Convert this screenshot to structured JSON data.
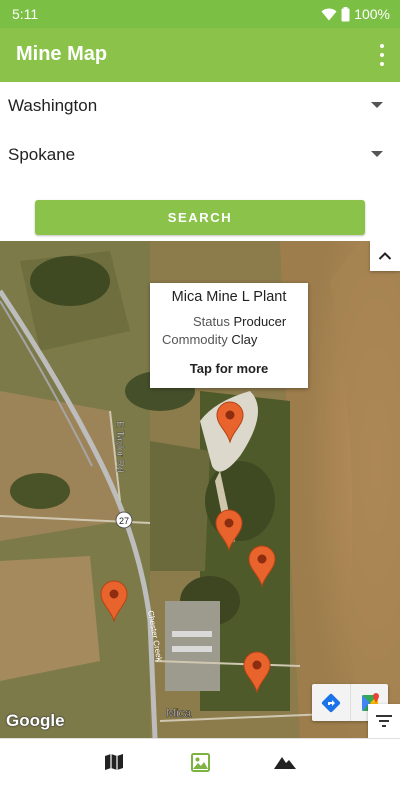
{
  "status_bar": {
    "time": "5:11",
    "battery": "100%",
    "icons": [
      "wifi-icon",
      "battery-icon"
    ]
  },
  "app_bar": {
    "title": "Mine Map",
    "menu_icon": "overflow-menu-icon"
  },
  "filters": {
    "state": {
      "value": "Washington"
    },
    "county": {
      "value": "Spokane"
    },
    "search_label": "SEARCH"
  },
  "map": {
    "info_window": {
      "title": "Mica Mine L Plant",
      "status_label": "Status",
      "status_value": "Producer",
      "commodity_label": "Commodity",
      "commodity_value": "Clay",
      "more_label": "Tap for more"
    },
    "markers": 5,
    "labels": {
      "road": "E Taylor Rd",
      "highway": "27",
      "creek": "Chester Creek",
      "town": "Mica"
    },
    "attribution": "Google",
    "colors": {
      "marker": "#e8642c",
      "marker_dot": "#8b2d0e"
    }
  },
  "bottom_nav": {
    "items": [
      {
        "icon": "map-icon",
        "selected": false
      },
      {
        "icon": "satellite-image-icon",
        "selected": true
      },
      {
        "icon": "terrain-icon",
        "selected": false
      }
    ],
    "accent": "#7cb342"
  }
}
